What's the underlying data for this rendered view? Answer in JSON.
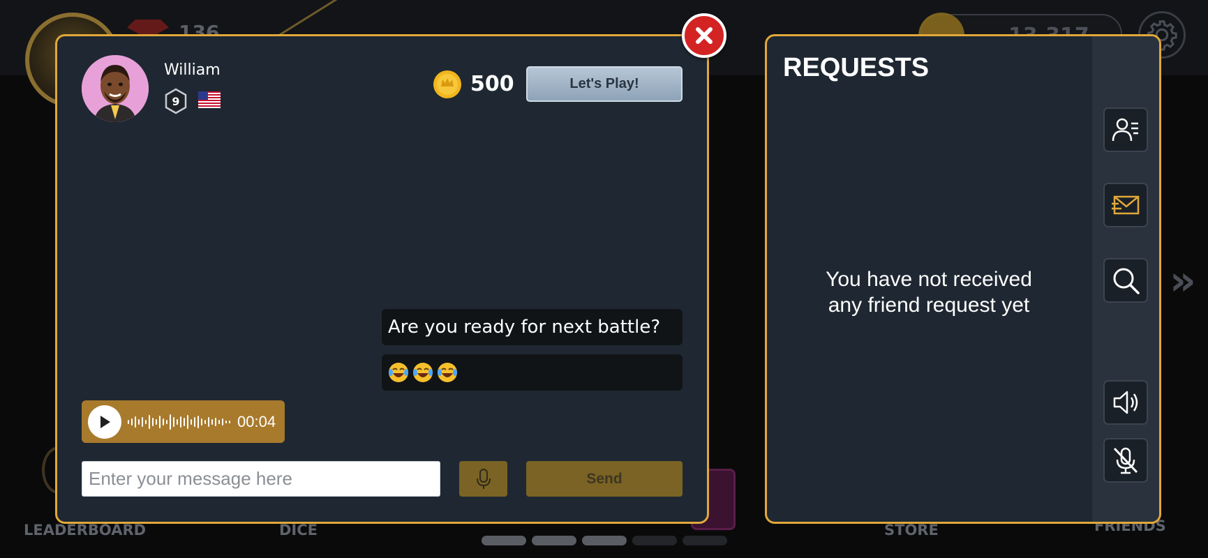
{
  "background": {
    "gem_count": "136",
    "coin_count": "13,317",
    "nav": [
      "LEADERBOARD",
      "DICE",
      "STORE",
      "FRIENDS"
    ]
  },
  "chat": {
    "player": {
      "name": "William",
      "level": "9",
      "flag": "US"
    },
    "coins": "500",
    "play_button": "Let's Play!",
    "messages": [
      {
        "type": "text",
        "text": "Are you ready for next battle?"
      },
      {
        "type": "emoji",
        "count": 3,
        "icon": "laughing-tears-emoji"
      }
    ],
    "voice_message": {
      "duration": "00:04"
    },
    "input": {
      "placeholder": "Enter your message here",
      "value": ""
    },
    "send_button": "Send"
  },
  "requests": {
    "title": "REQUESTS",
    "empty_message_line1": "You have not received",
    "empty_message_line2": "any friend request yet",
    "sidebar_icons": [
      "friends-list-icon",
      "mail-icon",
      "search-icon",
      "speaker-icon",
      "mic-muted-icon"
    ]
  },
  "colors": {
    "accent_gold": "#e2a83a",
    "panel_bg": "#1f2832",
    "close_red": "#d42323"
  }
}
